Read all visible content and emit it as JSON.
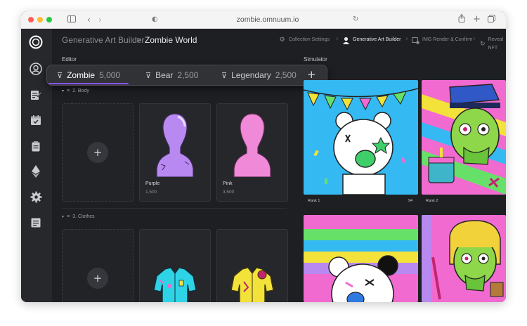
{
  "browser": {
    "url": "zombie.omnuum.io"
  },
  "breadcrumb": {
    "parent": "Generative Art Builder",
    "separator": ">",
    "current": "Zombie World"
  },
  "steps": [
    {
      "label": "Collection Settings",
      "icon": "gear-icon",
      "active": false
    },
    {
      "label": "Generative Art Builder",
      "icon": "user-icon",
      "active": true
    },
    {
      "label": "IMG Render & Confirm",
      "icon": "image-gear-icon",
      "active": false
    },
    {
      "label": "Reveal NFT",
      "icon": "refresh-icon",
      "active": false
    }
  ],
  "editor": {
    "label": "Editor",
    "tabs": [
      {
        "name": "Zombie",
        "count": "5,000"
      },
      {
        "name": "Bear",
        "count": "2,500"
      },
      {
        "name": "Legendary",
        "count": "2,500"
      }
    ],
    "add_tab": "+",
    "sections": [
      {
        "title": "2. Body",
        "items": [
          {
            "name": "Purple",
            "count": "1,500"
          },
          {
            "name": "Pink",
            "count": "3,500"
          }
        ]
      },
      {
        "title": "3. Clothes",
        "items": []
      }
    ],
    "add_item": "+"
  },
  "simulator": {
    "label": "Simulator",
    "cards": [
      {
        "rank": "Rank 1",
        "score": "94"
      },
      {
        "rank": "Rank 2",
        "score": ""
      },
      {
        "rank": "",
        "score": ""
      },
      {
        "rank": "",
        "score": ""
      }
    ]
  },
  "colors": {
    "accent": "#8a54ff",
    "background": "#1e1f22",
    "sidebar": "#27282c",
    "purple_body": "#b889f0",
    "pink_body": "#f08ad8"
  }
}
